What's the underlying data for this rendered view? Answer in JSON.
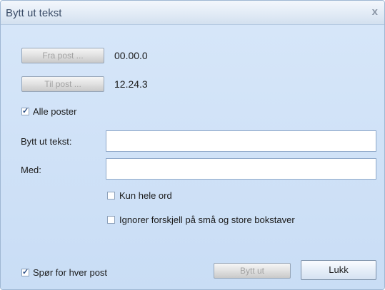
{
  "window": {
    "title": "Bytt ut tekst",
    "close_glyph": "x"
  },
  "range": {
    "from_button": "Fra post ...",
    "from_value": "00.00.0",
    "to_button": "Til post ...",
    "to_value": "12.24.3",
    "all_posts_label": "Alle poster",
    "all_posts_checked": true
  },
  "fields": {
    "replace_label": "Bytt ut tekst:",
    "replace_value": "",
    "with_label": "Med:",
    "with_value": ""
  },
  "options": {
    "whole_words_label": "Kun hele ord",
    "whole_words_checked": false,
    "ignore_case_label": "Ignorer forskjell på små og store bokstaver",
    "ignore_case_checked": false
  },
  "footer": {
    "ask_each_label": "Spør for hver post",
    "ask_each_checked": true,
    "replace_button": "Bytt ut",
    "close_button": "Lukk"
  }
}
